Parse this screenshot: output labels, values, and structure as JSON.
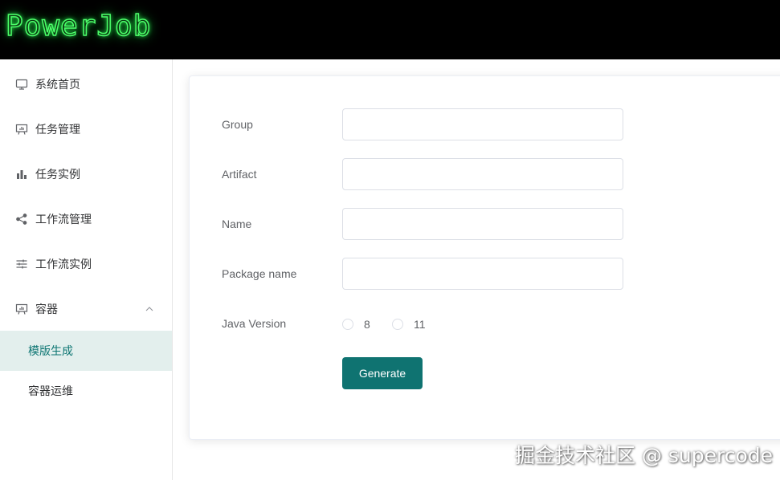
{
  "header": {
    "logo_text": "PowerJob"
  },
  "sidebar": {
    "items": [
      {
        "label": "系统首页",
        "icon": "monitor-icon"
      },
      {
        "label": "任务管理",
        "icon": "presentation-icon"
      },
      {
        "label": "任务实例",
        "icon": "bar-chart-icon"
      },
      {
        "label": "工作流管理",
        "icon": "share-icon"
      },
      {
        "label": "工作流实例",
        "icon": "sliders-icon"
      },
      {
        "label": "容器",
        "icon": "presentation-icon",
        "expanded": true
      }
    ],
    "sub_items": [
      {
        "label": "模版生成",
        "active": true
      },
      {
        "label": "容器运维",
        "active": false
      }
    ]
  },
  "form": {
    "group_label": "Group",
    "group_value": "",
    "artifact_label": "Artifact",
    "artifact_value": "",
    "name_label": "Name",
    "name_value": "",
    "package_label": "Package name",
    "package_value": "",
    "java_label": "Java Version",
    "java_options": [
      "8",
      "11"
    ],
    "generate_label": "Generate"
  },
  "watermark": "掘金技术社区 @ supercode",
  "colors": {
    "accent": "#0f7371",
    "active_bg": "#e3efed",
    "header_bg": "#000000"
  }
}
